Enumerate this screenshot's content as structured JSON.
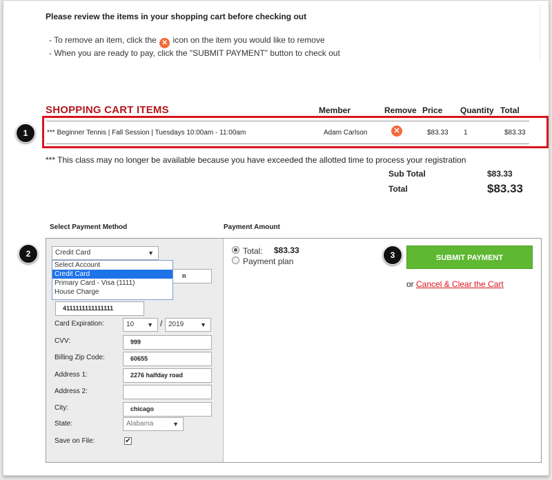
{
  "instructions": {
    "title": "Please review the items in your shopping cart before checking out",
    "line1_prefix": "- To remove an item, click the",
    "line1_suffix": "icon on the item you would like to remove",
    "line2": "- When you are ready to pay, click the \"SUBMIT PAYMENT\" button to check out"
  },
  "cart": {
    "title": "SHOPPING CART ITEMS",
    "headers": {
      "member": "Member",
      "remove": "Remove",
      "price": "Price",
      "quantity": "Quantity",
      "total": "Total"
    },
    "items": [
      {
        "description": "*** Beginner Tennis | Fall Session | Tuesdays 10:00am - 11:00am",
        "member": "Adam Carlson",
        "price": "$83.33",
        "quantity": "1",
        "total": "$83.33"
      }
    ],
    "notice": "*** This class may no longer be available because you have exceeded the allotted time to process your registration",
    "subtotal_label": "Sub Total",
    "subtotal_value": "$83.33",
    "total_label": "Total",
    "total_value": "$83.33"
  },
  "badges": {
    "one": "1",
    "two": "2",
    "three": "3"
  },
  "payment_method": {
    "heading": "Select Payment Method",
    "selected": "Credit Card",
    "options": [
      "Select Account",
      "Credit Card",
      "Primary Card - Visa (1111)",
      "House Charge"
    ],
    "name_on_card_value_partial": "n",
    "card_number": "4111111111111111",
    "card_expiration_label": "Card Expiration:",
    "exp_month": "10",
    "exp_sep": "/",
    "exp_year": "2019",
    "cvv_label": "CVV:",
    "cvv": "999",
    "zip_label": "Billing Zip Code:",
    "zip": "60655",
    "address1_label": "Address 1:",
    "address1": "2276 halfday road",
    "address2_label": "Address 2:",
    "address2": "",
    "city_label": "City:",
    "city": "chicago",
    "state_label": "State:",
    "state": "Alabama",
    "save_label": "Save on File:",
    "save_checked": true
  },
  "payment_amount": {
    "heading": "Payment Amount",
    "total_label": "Total:",
    "total_value": "$83.33",
    "plan_label": "Payment plan"
  },
  "actions": {
    "submit_label": "SUBMIT PAYMENT",
    "or_text": "or",
    "cancel_label": "Cancel & Clear the Cart"
  },
  "icons": {
    "remove": "close-circle-icon",
    "dropdown": "chevron-down-icon",
    "check": "checkmark-icon"
  },
  "colors": {
    "accent_red": "#d9141c",
    "cart_title": "#b5171d",
    "submit_green": "#5fb832",
    "remove_orange": "#f26b3a",
    "dropdown_highlight": "#1e73e8"
  }
}
